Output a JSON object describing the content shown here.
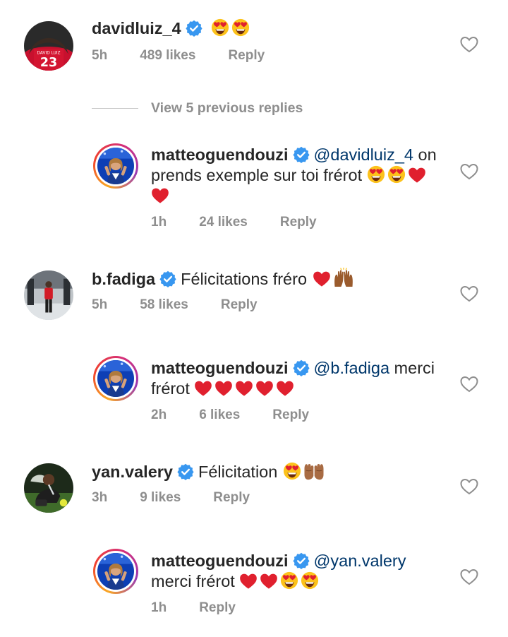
{
  "comments": [
    {
      "username": "davidluiz_4",
      "text": "",
      "time": "5h",
      "likes": "489 likes",
      "reply": "Reply"
    },
    {
      "username": "matteoguendouzi",
      "mention": "@davidluiz_4",
      "text": " on prends exemple sur toi frérot ",
      "time": "1h",
      "likes": "24 likes",
      "reply": "Reply"
    },
    {
      "username": "b.fadiga",
      "text": "Félicitations fréro",
      "time": "5h",
      "likes": "58 likes",
      "reply": "Reply"
    },
    {
      "username": "matteoguendouzi",
      "mention": "@b.fadiga",
      "text": " merci frérot ",
      "time": "2h",
      "likes": "6 likes",
      "reply": "Reply"
    },
    {
      "username": "yan.valery",
      "text": "Félicitation",
      "time": "3h",
      "likes": "9 likes",
      "reply": "Reply"
    },
    {
      "username": "matteoguendouzi",
      "mention": "@yan.valery",
      "text": "merci frérot",
      "time": "1h",
      "likes": "",
      "reply": "Reply"
    }
  ],
  "view_replies_label": "View 5 previous replies",
  "colors": {
    "text": "#262626",
    "meta": "#8e8e8e",
    "mention": "#00376b",
    "verified": "#3897f0",
    "heart_emoji": "#e0202e"
  },
  "icons": [
    "verified-badge-icon",
    "heart-outline-icon",
    "heart-eyes-emoji",
    "red-heart-emoji",
    "raised-hands-emoji",
    "palms-up-emoji"
  ]
}
